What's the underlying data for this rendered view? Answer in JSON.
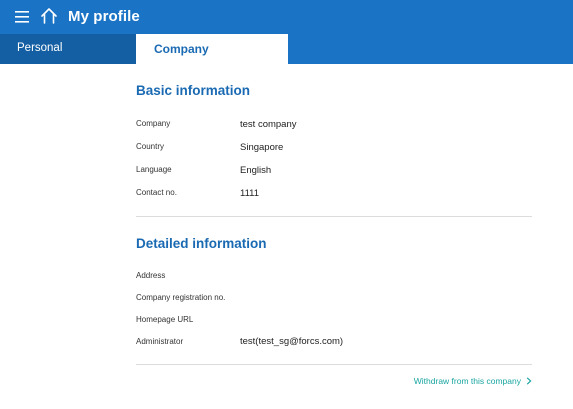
{
  "header": {
    "title": "My profile",
    "menu_icon": "hamburger-menu-icon",
    "home_icon": "home-icon",
    "bg_color": "#1a73c4"
  },
  "tabs": [
    {
      "label": "Personal",
      "active": false
    },
    {
      "label": "Company",
      "active": true
    }
  ],
  "basic": {
    "title": "Basic information",
    "fields": [
      {
        "label": "Company",
        "value": "test company"
      },
      {
        "label": "Country",
        "value": "Singapore"
      },
      {
        "label": "Language",
        "value": "English"
      },
      {
        "label": "Contact no.",
        "value": "1111"
      }
    ]
  },
  "detailed": {
    "title": "Detailed information",
    "fields": [
      {
        "label": "Address",
        "value": ""
      },
      {
        "label": "Company registration no.",
        "value": ""
      },
      {
        "label": "Homepage URL",
        "value": ""
      },
      {
        "label": "Administrator",
        "value": "test(test_sg@forcs.com)"
      }
    ]
  },
  "withdraw": {
    "label": "Withdraw from this company",
    "icon": "chevron-right-icon",
    "color": "#1aa5a0"
  },
  "accent_color": "#1a6ab3"
}
